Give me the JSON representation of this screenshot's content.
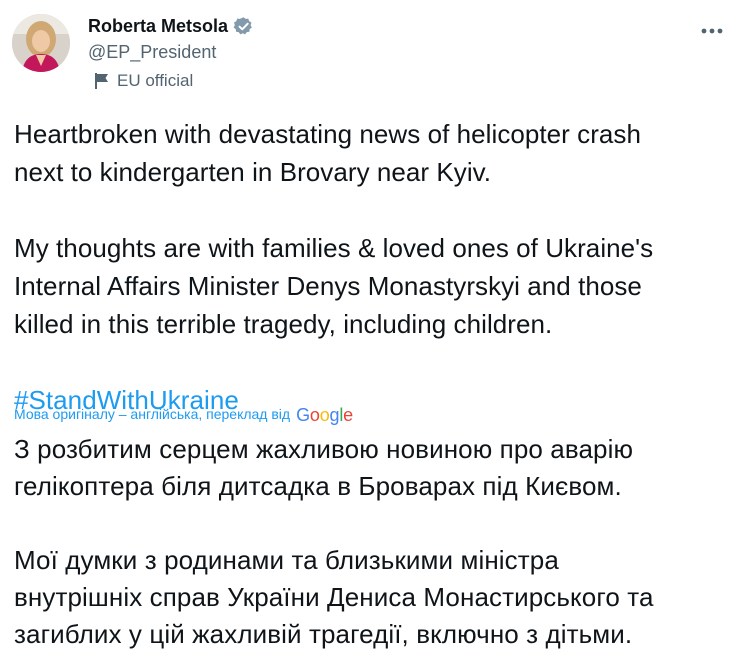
{
  "author": {
    "display_name": "Roberta Metsola",
    "handle": "@EP_President",
    "label": "EU official"
  },
  "tweet": {
    "paragraphs": [
      [
        "Heartbroken with devastating news of helicopter crash",
        "next to kindergarten in Brovary near Kyiv."
      ],
      [
        "My thoughts are with families & loved ones of Ukraine's",
        "Internal Affairs Minister Denys Monastyrskyi and those",
        "killed in this terrible tragedy, including children."
      ]
    ],
    "hashtag": "#StandWithUkraine"
  },
  "translation": {
    "notice": "Мова оригіналу – англійська, переклад від",
    "provider": "Google",
    "paragraphs": [
      [
        "З розбитим серцем жахливою новиною про аварію",
        "гелікоптера біля дитсадка в Броварах під Києвом."
      ],
      [
        "Мої думки з родинами та близькими міністра",
        "внутрішніх справ України Дениса Монастирського та",
        "загиблих у цій жахливій трагедії, включно з дітьми."
      ]
    ]
  },
  "icons": {
    "verified": "verified-badge-icon",
    "label": "flag-icon",
    "more": "more-icon"
  },
  "colors": {
    "text": "#0f1419",
    "secondary": "#536471",
    "link": "#1d9bf0",
    "google_blue": "#4285f4",
    "google_red": "#ea4335",
    "google_yellow": "#fbbc05",
    "google_green": "#34a853"
  }
}
